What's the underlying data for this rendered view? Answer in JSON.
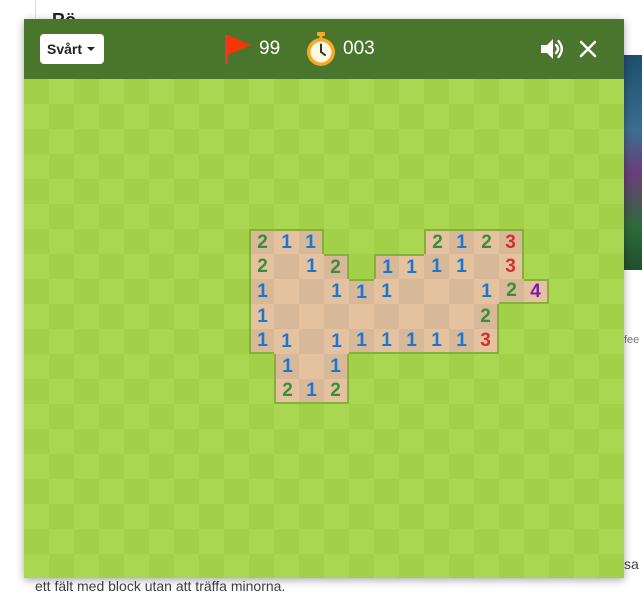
{
  "background": {
    "heading": "Rö",
    "side_text": "fee",
    "side_text2": "sa",
    "footer_text": "ett fält med block utan att träffa minorna."
  },
  "toolbar": {
    "difficulty": "Svårt",
    "flags_remaining": "99",
    "time": "003"
  },
  "colors": {
    "toolbar": "#4a752c",
    "grass_light": "#aad751",
    "grass_dark": "#a2d149",
    "revealed_light": "#e5c29f",
    "revealed_dark": "#d7b899",
    "num_1": "#1976d2",
    "num_2": "#388e3c",
    "num_3": "#d32f2f",
    "num_4": "#7b1fa2"
  },
  "board": {
    "cols": 24,
    "rows": 20,
    "revealed_cells": [
      [
        9,
        6,
        "2"
      ],
      [
        10,
        6,
        "1"
      ],
      [
        11,
        6,
        "1"
      ],
      [
        16,
        6,
        "2"
      ],
      [
        17,
        6,
        "1"
      ],
      [
        18,
        6,
        "2"
      ],
      [
        19,
        6,
        "3"
      ],
      [
        9,
        7,
        "2"
      ],
      [
        10,
        7,
        ""
      ],
      [
        11,
        7,
        "1"
      ],
      [
        12,
        7,
        "2"
      ],
      [
        14,
        7,
        "1"
      ],
      [
        15,
        7,
        "1"
      ],
      [
        16,
        7,
        "1"
      ],
      [
        17,
        7,
        "1"
      ],
      [
        18,
        7,
        ""
      ],
      [
        19,
        7,
        "3"
      ],
      [
        9,
        8,
        "1"
      ],
      [
        10,
        8,
        ""
      ],
      [
        11,
        8,
        ""
      ],
      [
        12,
        8,
        "1"
      ],
      [
        13,
        8,
        "1"
      ],
      [
        14,
        8,
        "1"
      ],
      [
        15,
        8,
        ""
      ],
      [
        16,
        8,
        ""
      ],
      [
        17,
        8,
        ""
      ],
      [
        18,
        8,
        "1"
      ],
      [
        19,
        8,
        "2"
      ],
      [
        20,
        8,
        "4"
      ],
      [
        9,
        9,
        "1"
      ],
      [
        10,
        9,
        ""
      ],
      [
        11,
        9,
        ""
      ],
      [
        12,
        9,
        ""
      ],
      [
        13,
        9,
        ""
      ],
      [
        14,
        9,
        ""
      ],
      [
        15,
        9,
        ""
      ],
      [
        16,
        9,
        ""
      ],
      [
        17,
        9,
        ""
      ],
      [
        18,
        9,
        "2"
      ],
      [
        9,
        10,
        "1"
      ],
      [
        10,
        10,
        "1"
      ],
      [
        11,
        10,
        ""
      ],
      [
        12,
        10,
        "1"
      ],
      [
        13,
        10,
        "1"
      ],
      [
        14,
        10,
        "1"
      ],
      [
        15,
        10,
        "1"
      ],
      [
        16,
        10,
        "1"
      ],
      [
        17,
        10,
        "1"
      ],
      [
        18,
        10,
        "3"
      ],
      [
        10,
        11,
        "1"
      ],
      [
        11,
        11,
        ""
      ],
      [
        12,
        11,
        "1"
      ],
      [
        10,
        12,
        "2"
      ],
      [
        11,
        12,
        "1"
      ],
      [
        12,
        12,
        "2"
      ]
    ]
  }
}
